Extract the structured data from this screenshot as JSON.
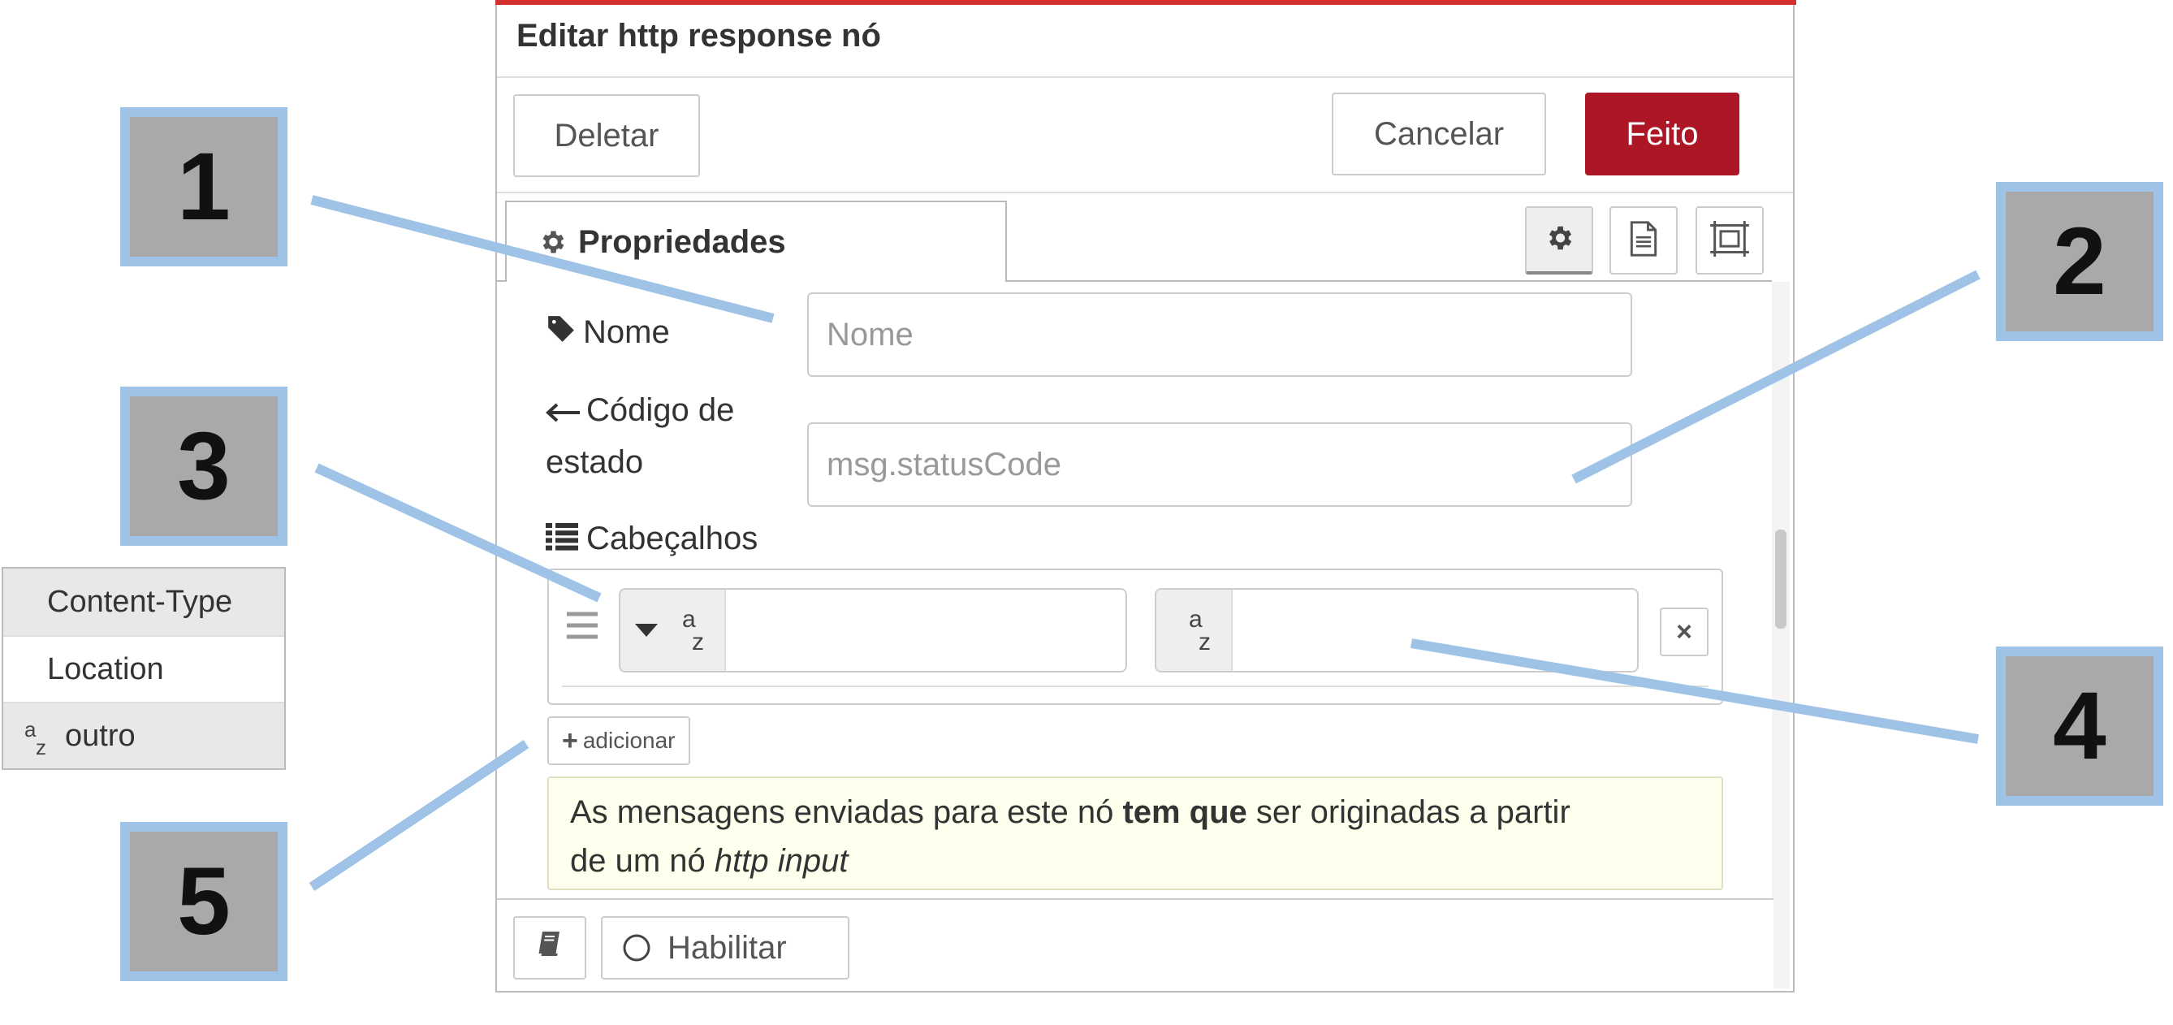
{
  "dialog": {
    "title": "Editar http response nó",
    "buttons": {
      "delete": "Deletar",
      "cancel": "Cancelar",
      "done": "Feito"
    },
    "accent_color": "#ad1625"
  },
  "tabs": {
    "properties": "Propriedades",
    "icons": [
      "gear-icon",
      "document-icon",
      "frame-icon"
    ]
  },
  "form": {
    "name": {
      "label": "Nome",
      "placeholder": "Nome",
      "value": ""
    },
    "status_code": {
      "label_line1": "Código de",
      "label_line2": "estado",
      "placeholder": "msg.statusCode",
      "value": ""
    },
    "headers": {
      "label": "Cabeçalhos",
      "rows": [
        {
          "key_type": "az",
          "key": "",
          "value_type": "az",
          "value": ""
        }
      ],
      "add_button": "adicionar"
    }
  },
  "tip": {
    "part1": "As mensagens enviadas para este nó ",
    "bold": "tem que",
    "part2": " ser originadas a partir",
    "line2_prefix": "de um nó ",
    "italic": "http input"
  },
  "footer": {
    "enable_label": "Habilitar"
  },
  "header_type_menu": {
    "items": [
      "Content-Type",
      "Location"
    ],
    "other": "outro",
    "az_a": "a",
    "az_z": "z"
  },
  "callouts": [
    "1",
    "2",
    "3",
    "4",
    "5"
  ]
}
